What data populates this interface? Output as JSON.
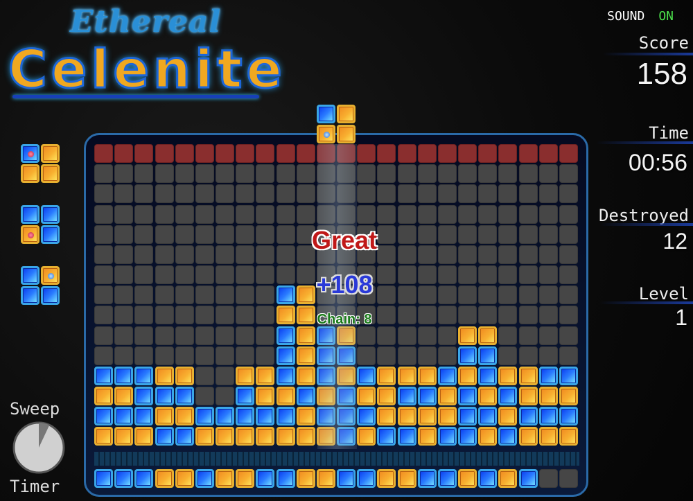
{
  "logo": {
    "line1": "Ethereal",
    "line2": "Celenite"
  },
  "sound": {
    "label": "SOUND",
    "state": "ON",
    "state_color": "#4ce04c"
  },
  "stats": {
    "score_label": "Score",
    "score": "158",
    "time_label": "Time",
    "time": "00:56",
    "destroyed_label": "Destroyed",
    "destroyed": "12",
    "level_label": "Level",
    "level": "1"
  },
  "popup": {
    "rating": "Great",
    "points": "+108",
    "chain": "Chain: 8"
  },
  "sweep_timer": {
    "label_top": "Sweep",
    "label_bottom": "Timer",
    "elapsed_fraction": 0.07
  },
  "colors": {
    "blue": "#2a7cff",
    "orange": "#f8b030",
    "empty": "#464646",
    "top_row": "#8a2e2e",
    "frame": "#2a6aa8"
  },
  "falling_piece": {
    "column": 11,
    "cells": [
      [
        "B",
        "O"
      ],
      [
        "O*h",
        "O"
      ]
    ]
  },
  "queue": [
    [
      [
        "B*x",
        "O"
      ],
      [
        "O",
        "O"
      ]
    ],
    [
      [
        "B",
        "B"
      ],
      [
        "O*x",
        "B"
      ]
    ],
    [
      [
        "B",
        "O*h"
      ],
      [
        "B",
        "B"
      ]
    ]
  ],
  "board": {
    "columns": 24,
    "rows": [
      "RRRRRRRRRRRRRRRRRRRRRRRR",
      "........................",
      "........................",
      "........................",
      "........................",
      "........................",
      "........................",
      ".........BO.............",
      ".........OO.............",
      ".........BOBO.....OO....",
      ".........BOBB.....BB....",
      "BBBOO..OOBOBOBOOOBOBOOBB",
      "OOBBB..BOOBOBOOBBOBOBOOO",
      "BBBOOBBBBBOBBBOOOOBBOBBB",
      "OOOBBOOOOOOOBOBBOBBOBOOO"
    ],
    "next_row": "BBBOOBOOBBOOBBOOBBOBOB.."
  }
}
